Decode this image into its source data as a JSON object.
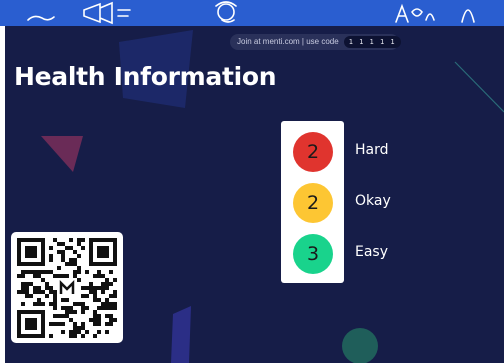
{
  "header": {
    "join_text": "Join at menti.com | use code",
    "code": "1 1 1 1 1"
  },
  "slide": {
    "title": "Health Information"
  },
  "results": [
    {
      "count": "2",
      "label": "Hard",
      "color": "#e0342e"
    },
    {
      "count": "2",
      "label": "Okay",
      "color": "#fdc633"
    },
    {
      "count": "3",
      "label": "Easy",
      "color": "#19d38c"
    }
  ],
  "colors": {
    "background": "#161d48",
    "banner": "#2a5ed0"
  },
  "icons": [
    "qr-code-icon",
    "mentimeter-logo-icon"
  ]
}
